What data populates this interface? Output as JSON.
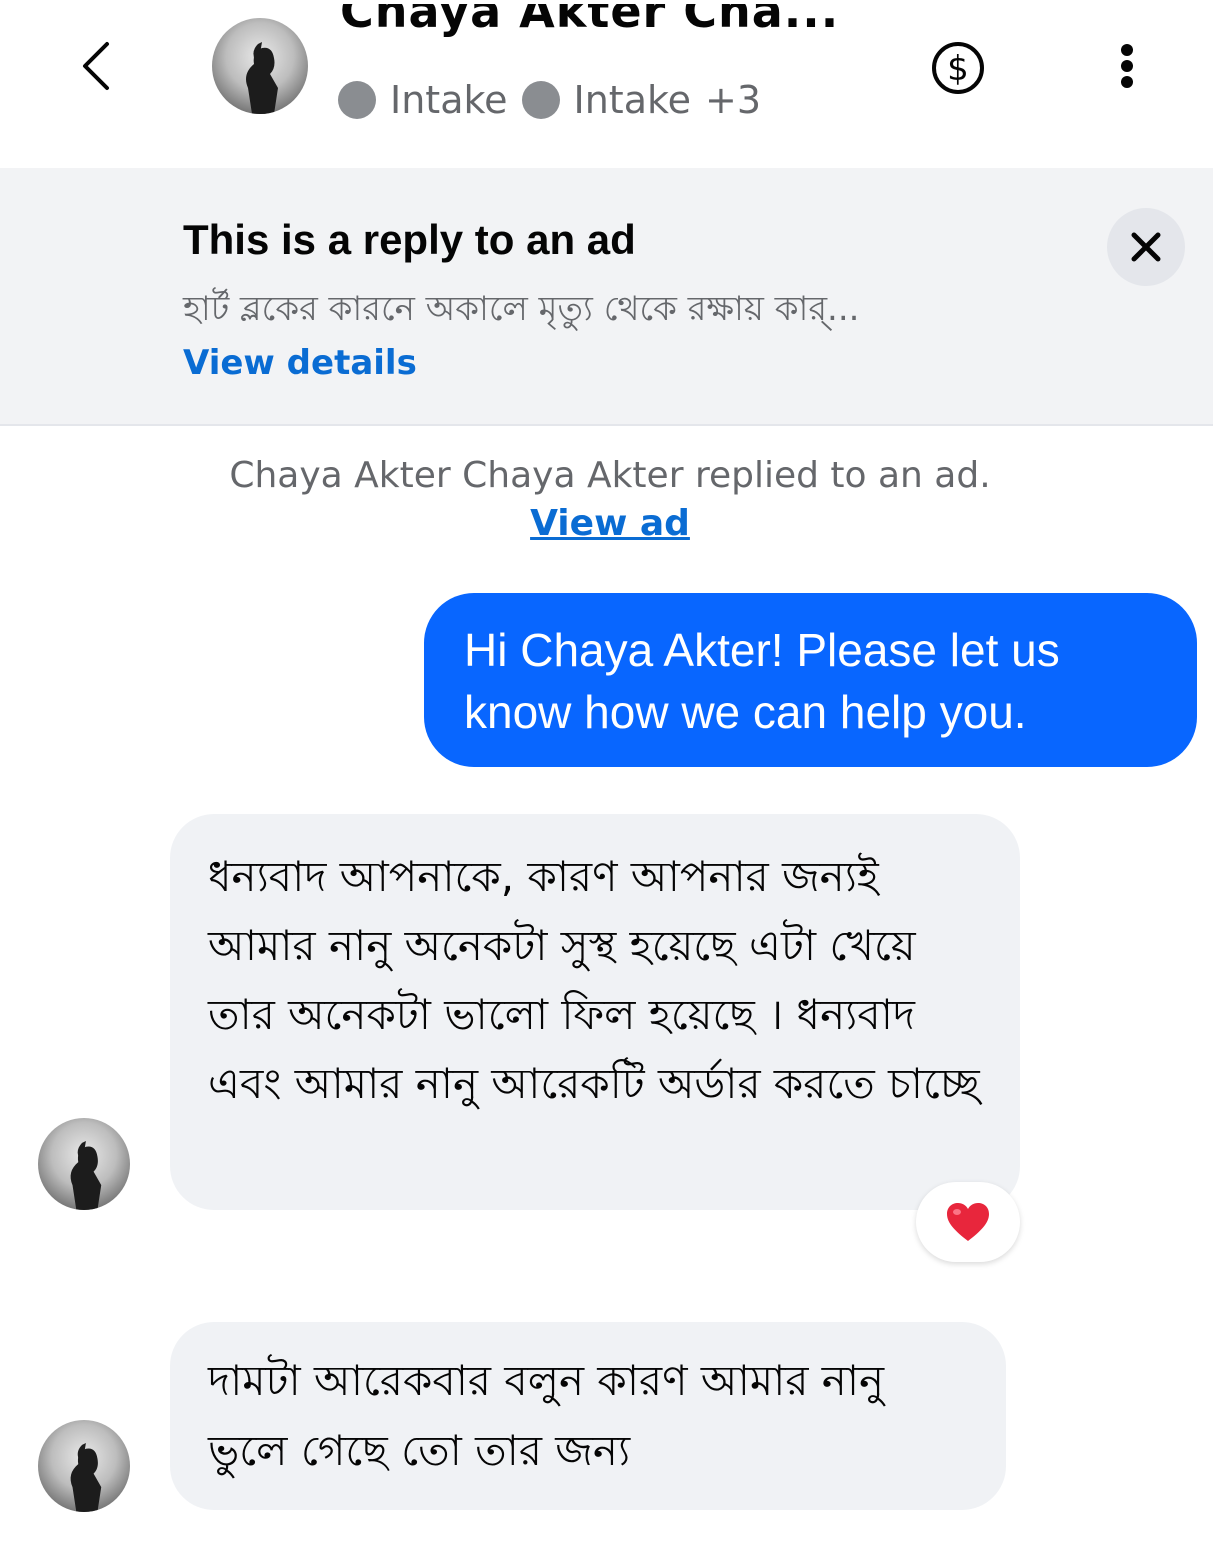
{
  "header": {
    "contact_name": "Chaya Akter Cha...",
    "labels": [
      "Intake",
      "Intake"
    ],
    "more_labels": "+3",
    "back_icon": "chevron-left-icon",
    "payment_icon": "dollar-circle-icon",
    "menu_icon": "more-vertical-icon"
  },
  "ad_banner": {
    "title": "This is a reply to an ad",
    "description": "হার্ট ব্লকের কারনে অকালে মৃত্যু থেকে রক্ষায় কার্...",
    "view_details_label": "View details",
    "close_icon": "close-icon"
  },
  "system_note": {
    "text": "Chaya Akter Chaya Akter replied to an ad.",
    "link_label": "View ad"
  },
  "messages": [
    {
      "direction": "outgoing",
      "text": "Hi Chaya Akter! Please let us know how we can help you."
    },
    {
      "direction": "incoming",
      "text": "ধন্যবাদ আপনাকে, কারণ আপনার জন্যই আমার নানু অনেকটা সুস্থ হয়েছে এটা খেয়ে তার অনেকটা ভালো ফিল হয়েছে । ধন্যবাদ এবং আমার নানু আরেকটি অর্ডার করতে চাচ্ছে",
      "reaction": "❤️"
    },
    {
      "direction": "incoming",
      "text": "দামটা আরেকবার বলুন কারণ আমার নানু ভুলে গেছে তো তার জন্য"
    }
  ],
  "colors": {
    "outgoing_bubble": "#0866ff",
    "incoming_bubble": "#f0f2f5",
    "link": "#0a6cd3",
    "banner_bg": "#f2f3f5"
  }
}
